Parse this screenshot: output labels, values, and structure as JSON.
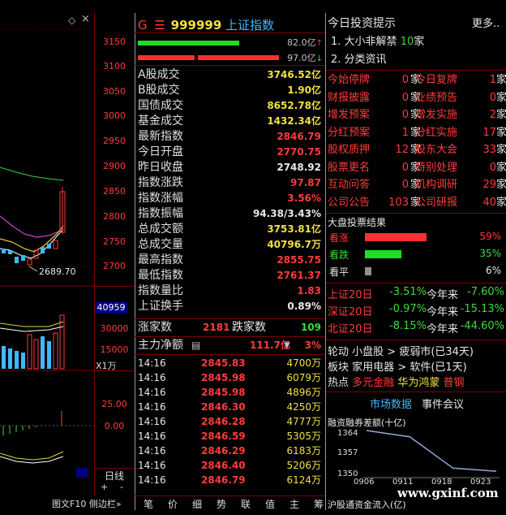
{
  "chart": {
    "y_ticks": [
      "3150",
      "3100",
      "3050",
      "3000",
      "2950",
      "2900",
      "2850",
      "2800",
      "2750",
      "2700"
    ],
    "low_marker": "2689.70",
    "vol_badge": "40959",
    "vol_ticks": [
      "30000",
      "15000"
    ],
    "vol_unit": "X1万",
    "macd_ticks": [
      "25.00",
      "0.00"
    ],
    "period_label": "日线",
    "plus": "+",
    "minus": "-",
    "bottom_tabs": "图文F10 侧边栏»"
  },
  "quote": {
    "code": "999999",
    "name": "上证指数",
    "flag": "G",
    "bar1": "82.0亿",
    "bar2": "97.0亿",
    "stats": [
      {
        "label": "A股成交",
        "value": "3746.52亿",
        "color": "yel"
      },
      {
        "label": "B股成交",
        "value": "1.90亿",
        "color": "yel"
      },
      {
        "label": "国债成交",
        "value": "8652.78亿",
        "color": "yel"
      },
      {
        "label": "基金成交",
        "value": "1432.34亿",
        "color": "yel"
      },
      {
        "label": "最新指数",
        "value": "2846.79",
        "color": "red"
      },
      {
        "label": "今日开盘",
        "value": "2770.75",
        "color": "red"
      },
      {
        "label": "昨日收盘",
        "value": "2748.92",
        "color": "wht"
      },
      {
        "label": "指数涨跌",
        "value": "97.87",
        "color": "red"
      },
      {
        "label": "指数涨幅",
        "value": "3.56%",
        "color": "red"
      },
      {
        "label": "指数振幅",
        "value": "94.38/3.43%",
        "color": "wht"
      },
      {
        "label": "总成交额",
        "value": "3753.81亿",
        "color": "yel"
      },
      {
        "label": "总成交量",
        "value": "40796.7万",
        "color": "yel"
      },
      {
        "label": "最高指数",
        "value": "2855.75",
        "color": "red"
      },
      {
        "label": "最低指数",
        "value": "2761.37",
        "color": "red"
      },
      {
        "label": "指数量比",
        "value": "1.83",
        "color": "red"
      },
      {
        "label": "上证换手",
        "value": "0.89%",
        "color": "wht"
      }
    ],
    "up_label": "涨家数",
    "up_count": "2181",
    "down_label": "跌家数",
    "down_count": "109",
    "main_flow_label": "主力净额",
    "main_flow_value": "111.7亿",
    "main_flow_pct": "3%",
    "ticks": [
      {
        "time": "14:16",
        "price": "2845.83",
        "vol": "4700万"
      },
      {
        "time": "14:16",
        "price": "2845.98",
        "vol": "6079万"
      },
      {
        "time": "14:16",
        "price": "2845.98",
        "vol": "4896万"
      },
      {
        "time": "14:16",
        "price": "2846.30",
        "vol": "4250万"
      },
      {
        "time": "14:16",
        "price": "2846.28",
        "vol": "4777万"
      },
      {
        "time": "14:16",
        "price": "2846.59",
        "vol": "5305万"
      },
      {
        "time": "14:16",
        "price": "2846.29",
        "vol": "6183万"
      },
      {
        "time": "14:16",
        "price": "2846.40",
        "vol": "5206万"
      },
      {
        "time": "14:16",
        "price": "2846.79",
        "vol": "6124万"
      }
    ],
    "bottom_tabs": [
      "笔",
      "价",
      "细",
      "势",
      "联",
      "值",
      "主",
      "筹"
    ]
  },
  "right": {
    "title": "今日投资提示",
    "more": "更多..",
    "tips": [
      {
        "text": "1. 大小非解禁",
        "count": "10",
        "unit": "家"
      },
      {
        "text": "2. 分类资讯",
        "count": "",
        "unit": ""
      }
    ],
    "events": [
      [
        "今始停牌",
        "0",
        "今日复牌",
        "1"
      ],
      [
        "财报披露",
        "0",
        "业绩预告",
        "0"
      ],
      [
        "增发预案",
        "0",
        "增发实施",
        "2"
      ],
      [
        "分红预案",
        "1",
        "分红实施",
        "17"
      ],
      [
        "股权质押",
        "12",
        "股东大会",
        "33"
      ],
      [
        "股票更名",
        "0",
        "特别处理",
        "0"
      ],
      [
        "互动问答",
        "0",
        "机构调研",
        "29"
      ],
      [
        "公司公告",
        "103",
        "公司研报",
        "40"
      ]
    ],
    "unit": "家",
    "vote_title": "大盘投票结果",
    "votes": [
      {
        "label": "看涨",
        "pct": "59%",
        "fill": 0.59,
        "color": "#ff3030"
      },
      {
        "label": "看跌",
        "pct": "35%",
        "fill": 0.35,
        "color": "#20dd20"
      },
      {
        "label": "看平",
        "pct": "6%",
        "fill": 0.06,
        "color": "#909090"
      }
    ],
    "index20": [
      {
        "name": "上证20日",
        "v1": "-3.51%",
        "lbl": "今年来",
        "v2": "-7.60%"
      },
      {
        "name": "深证20日",
        "v1": "-0.97%",
        "lbl": "今年来",
        "v2": "-15.13%"
      },
      {
        "name": "北证20日",
        "v1": "-8.15%",
        "lbl": "今年来",
        "v2": "-44.60%"
      }
    ],
    "rotation": {
      "label": "轮动",
      "text": "小盘股 > 疲弱市(已34天)"
    },
    "sector": {
      "label": "板块",
      "text": "家用电器 > 软件(已1天)"
    },
    "hot": {
      "label": "热点",
      "items": [
        "多元金融",
        "华为鸿蒙",
        "普钢"
      ]
    },
    "tab_market": "市场数据",
    "tab_events": "事件会议",
    "margin_title": "融资融券差额(十亿)",
    "margin_y": [
      "1364",
      "1357",
      "1350"
    ],
    "margin_x": [
      "0906",
      "0911",
      "0918",
      "0923"
    ],
    "hk_flow": "沪股通资金流入(亿)",
    "watermark": "www.gxinf.com"
  },
  "chart_data": {
    "type": "line",
    "title": "",
    "xlabel": "",
    "ylabel": "",
    "x": [
      "0906",
      "0911",
      "0918",
      "0923"
    ],
    "series": [
      {
        "values": [
          1364,
          1362,
          1352,
          1351
        ]
      }
    ],
    "ylim": [
      1350,
      1364
    ]
  }
}
